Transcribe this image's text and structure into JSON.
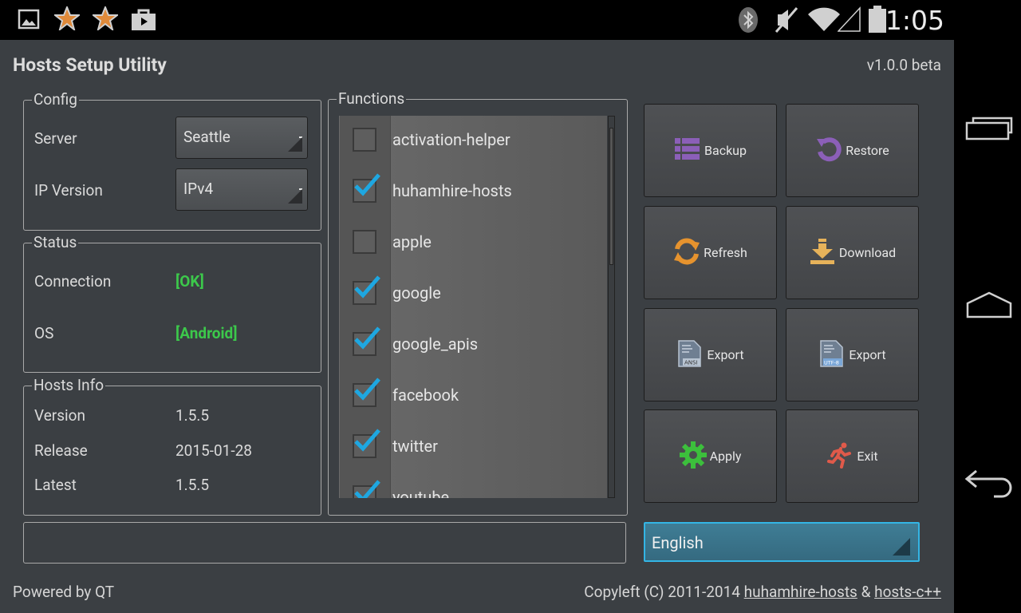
{
  "status_bar": {
    "time": "1:05"
  },
  "app": {
    "title": "Hosts Setup Utility",
    "version": "v1.0.0 beta"
  },
  "config": {
    "legend": "Config",
    "server_label": "Server",
    "server_value": "Seattle",
    "ip_label": "IP Version",
    "ip_value": "IPv4"
  },
  "status": {
    "legend": "Status",
    "connection_label": "Connection",
    "connection_value": "[OK]",
    "os_label": "OS",
    "os_value": "[Android]"
  },
  "hosts_info": {
    "legend": "Hosts Info",
    "version_label": "Version",
    "version_value": "1.5.5",
    "release_label": "Release",
    "release_value": "2015-01-28",
    "latest_label": "Latest",
    "latest_value": "1.5.5"
  },
  "functions": {
    "legend": "Functions",
    "items": [
      {
        "label": "activation-helper",
        "checked": false
      },
      {
        "label": "huhamhire-hosts",
        "checked": true
      },
      {
        "label": "apple",
        "checked": false
      },
      {
        "label": "google",
        "checked": true
      },
      {
        "label": "google_apis",
        "checked": true
      },
      {
        "label": "facebook",
        "checked": true
      },
      {
        "label": "twitter",
        "checked": true
      },
      {
        "label": "youtube",
        "checked": true
      }
    ]
  },
  "buttons": {
    "backup": "Backup",
    "restore": "Restore",
    "refresh": "Refresh",
    "download": "Download",
    "export_ansi": "Export",
    "export_utf8": "Export",
    "apply": "Apply",
    "exit": "Exit"
  },
  "language": {
    "value": "English"
  },
  "footer": {
    "powered": "Powered by QT",
    "copyleft": "Copyleft (C) 2011-2014",
    "link1": "huhamhire-hosts",
    "amp": "&",
    "link2": "hosts-c++"
  },
  "colors": {
    "ok_green": "#3cc84b",
    "accent_blue": "#33b5e5",
    "check_blue": "#1ea7e1"
  }
}
